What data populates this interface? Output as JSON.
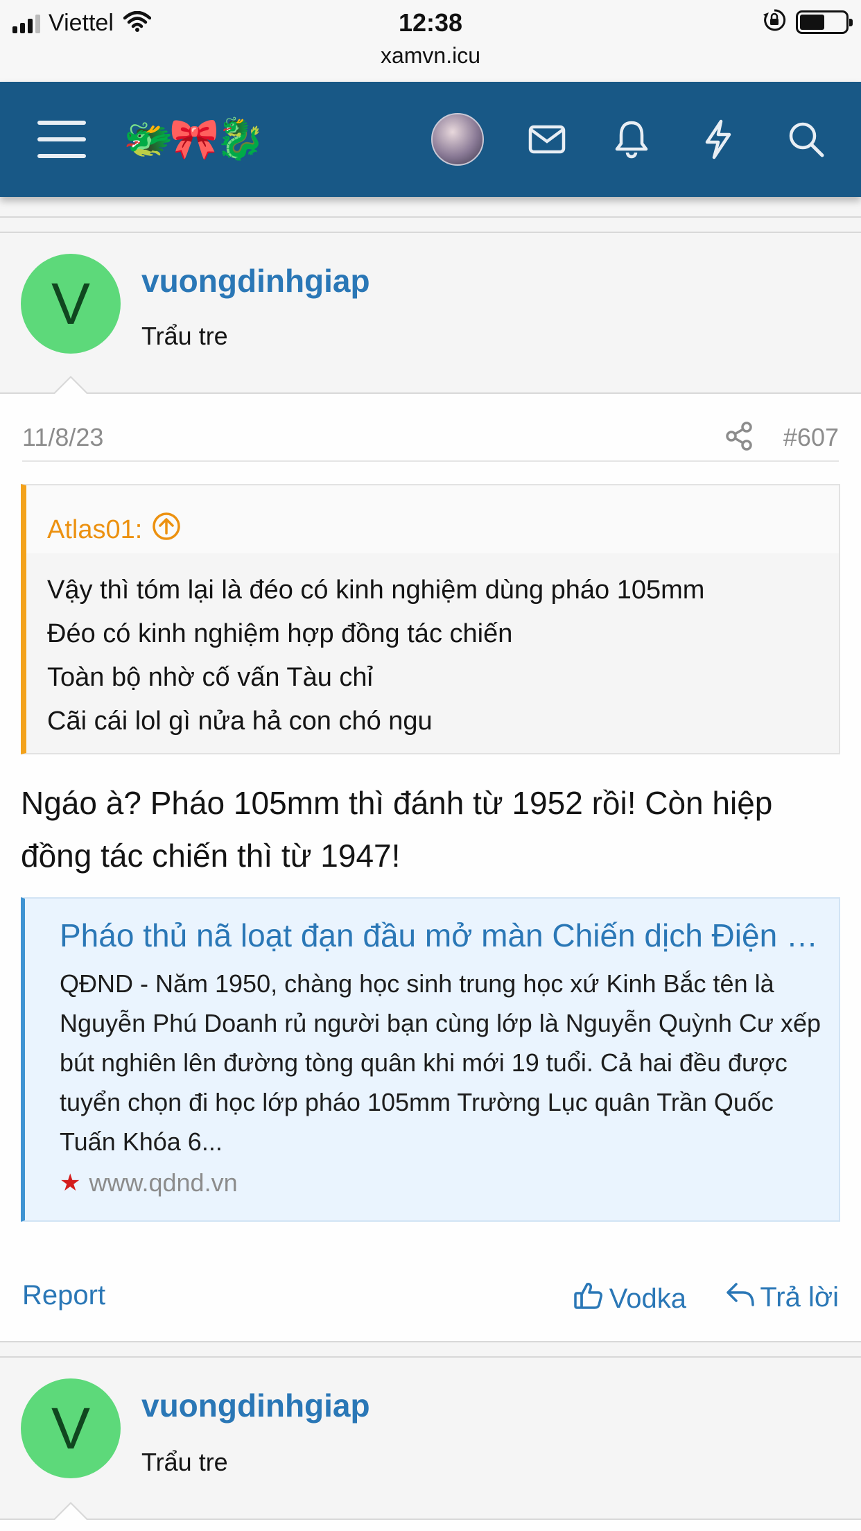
{
  "status_bar": {
    "carrier": "Viettel",
    "time": "12:38",
    "url": "xamvn.icu"
  },
  "nav": {
    "logo": "🐲🎀🐉",
    "icons": [
      "menu-icon",
      "avatar",
      "mail-icon",
      "bell-icon",
      "lightning-icon",
      "search-icon"
    ]
  },
  "posts": [
    {
      "username": "vuongdinhgiap",
      "avatar_letter": "V",
      "user_title": "Trẩu tre",
      "date": "11/8/23",
      "post_number": "#607",
      "quote": {
        "author": "Atlas01:",
        "lines": [
          "Vậy thì tóm lại là đéo có kinh nghiệm dùng pháo 105mm",
          "Đéo có kinh nghiệm hợp đồng tác chiến",
          "Toàn bộ nhờ cố vấn Tàu chỉ",
          "Cãi cái lol gì nửa hả con chó ngu"
        ]
      },
      "text": "Ngáo à? Pháo 105mm thì đánh từ 1952 rồi! Còn hiệp đồng tác chiến thì từ 1947!",
      "link_preview": {
        "title": "Pháo thủ nã loạt đạn đầu mở màn Chiến dịch Điện Biên Phủ",
        "description": "QĐND - Năm 1950, chàng học sinh trung học xứ Kinh Bắc tên là Nguyễn Phú Doanh rủ người bạn cùng lớp là Nguyễn Quỳnh Cư xếp bút nghiên lên đường tòng quân khi mới 19 tuổi. Cả hai đều được tuyển chọn đi học lớp pháo 105mm Trường Lục quân Trần Quốc Tuấn Khóa 6...",
        "site": "www.qdnd.vn"
      },
      "actions": {
        "report": "Report",
        "like": "Vodka",
        "reply": "Trả lời"
      }
    },
    {
      "username": "vuongdinhgiap",
      "avatar_letter": "V",
      "user_title": "Trẩu tre"
    }
  ],
  "colors": {
    "nav_bg": "#185886",
    "link_blue": "#2a77b6",
    "quote_accent": "#f3a21b",
    "avatar_green": "#5dd97a"
  }
}
